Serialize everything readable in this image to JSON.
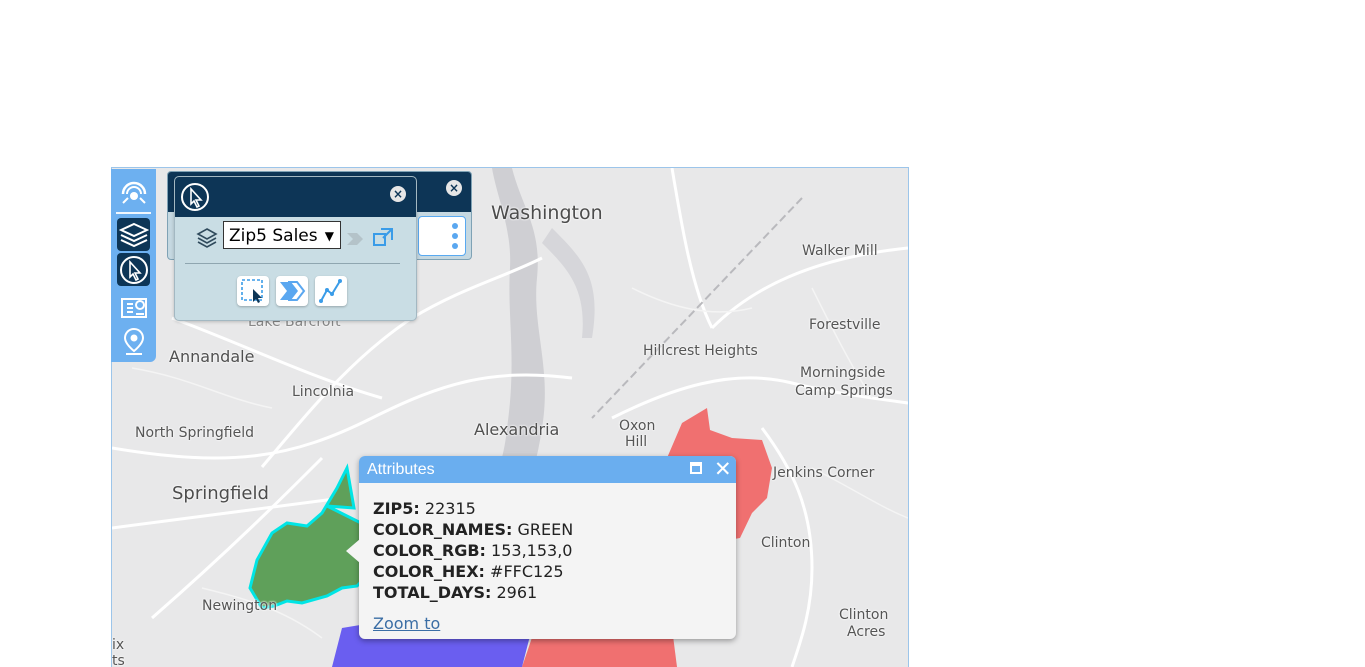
{
  "map": {
    "places": {
      "washington": "Washington",
      "walker_mill": "Walker Mill",
      "forestville": "Forestville",
      "hillcrest_heights": "Hillcrest Heights",
      "morningside": "Morningside",
      "camp_springs": "Camp Springs",
      "annandale": "Annandale",
      "lake_barcroft": "Lake Barcroft",
      "lincolnia": "Lincolnia",
      "alexandria": "Alexandria",
      "oxon": "Oxon",
      "hill": "Hill",
      "north_springfield": "North Springfield",
      "jenkins_corner": "Jenkins Corner",
      "springfield": "Springfield",
      "clinton": "Clinton",
      "newington": "Newington",
      "clinton2": "Clinton",
      "acres": "Acres",
      "edge_x": "ix",
      "edge_ts": "ts"
    },
    "zip_colors": {
      "green": "#5fa05a",
      "red": "#f07070",
      "blue": "#6a5ef0",
      "highlight": "#00e5e5"
    }
  },
  "toolbar": {
    "items": [
      {
        "icon": "overview-icon"
      },
      {
        "icon": "layers-icon"
      },
      {
        "icon": "select-icon"
      },
      {
        "icon": "map-legend-icon"
      },
      {
        "icon": "location-pin-icon"
      }
    ]
  },
  "select_panel": {
    "layer_selected": "Zip5 Sales",
    "close_label": "×"
  },
  "back_panel": {
    "close_label": "×"
  },
  "popup": {
    "title": "Attributes",
    "fields": [
      {
        "label": "ZIP5:",
        "value": "22315"
      },
      {
        "label": "COLOR_NAMES:",
        "value": "GREEN"
      },
      {
        "label": "COLOR_RGB:",
        "value": "153,153,0"
      },
      {
        "label": "COLOR_HEX:",
        "value": "#FFC125"
      },
      {
        "label": "TOTAL_DAYS:",
        "value": "2961"
      }
    ],
    "zoom_link": "Zoom to",
    "close_label": "✕"
  }
}
